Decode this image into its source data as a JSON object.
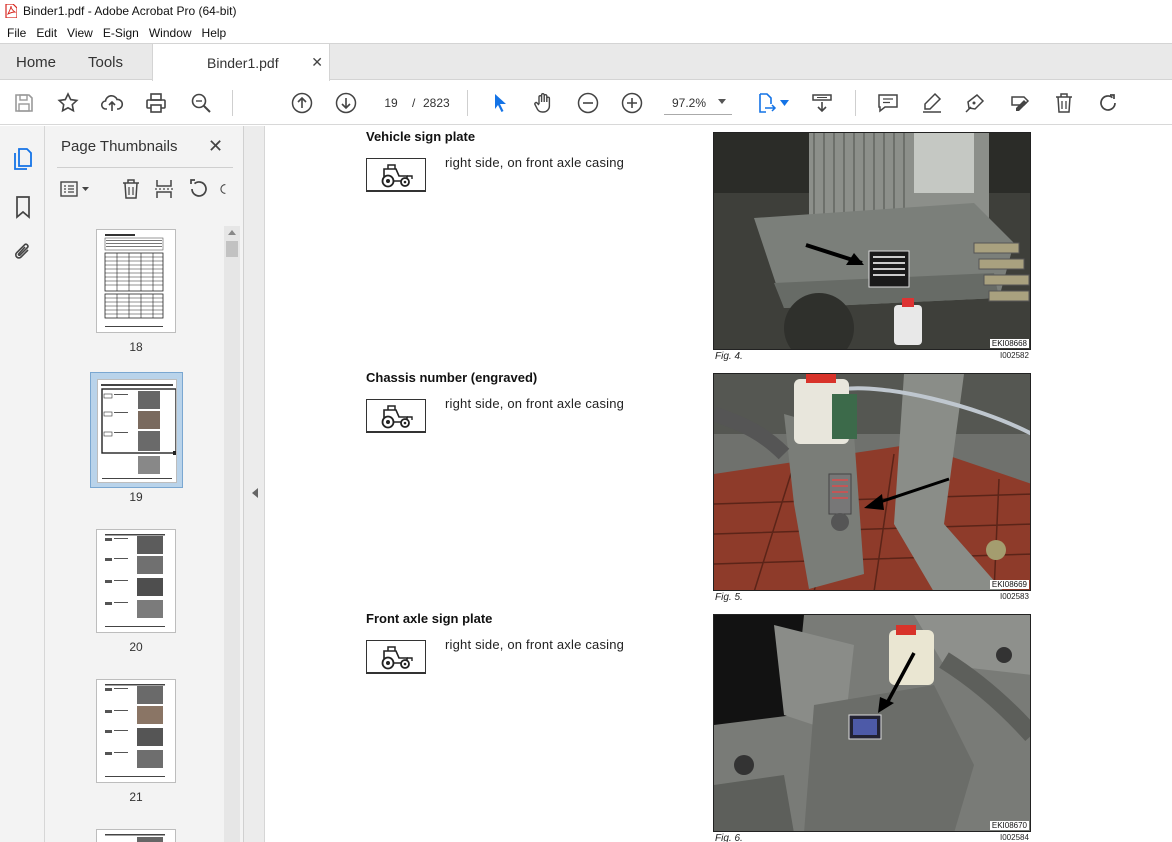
{
  "window": {
    "title": "Binder1.pdf - Adobe Acrobat Pro (64-bit)"
  },
  "menu": [
    "File",
    "Edit",
    "View",
    "E-Sign",
    "Window",
    "Help"
  ],
  "tabs": {
    "home": "Home",
    "tools": "Tools",
    "document": "Binder1.pdf"
  },
  "toolbar": {
    "current_page": "19",
    "page_separator": "/",
    "total_pages": "2823",
    "zoom": "97.2%"
  },
  "thumbnails_panel": {
    "title": "Page Thumbnails",
    "pages": [
      {
        "label": "18",
        "selected": false
      },
      {
        "label": "19",
        "selected": true
      },
      {
        "label": "20",
        "selected": false
      },
      {
        "label": "21",
        "selected": false
      }
    ]
  },
  "document": {
    "sections": [
      {
        "title": "Vehicle sign plate",
        "text": "right side, on front axle casing",
        "figure": "Fig. 4.",
        "photo_code": "EKI08668",
        "ref": "I002582"
      },
      {
        "title": "Chassis number (engraved)",
        "text": "right side, on front axle casing",
        "figure": "Fig. 5.",
        "photo_code": "EKI08669",
        "ref": "I002583"
      },
      {
        "title": "Front axle sign plate",
        "text": "right side, on front axle casing",
        "figure": "Fig. 6.",
        "photo_code": "EKI08670",
        "ref": "I002584"
      }
    ]
  },
  "colors": {
    "accent_blue": "#1473e6",
    "acrobat_red": "#d7261e",
    "selection": "#b9d3ea"
  },
  "icons": [
    "save-icon",
    "bookmark-star-icon",
    "upload-icon",
    "print-icon",
    "zoom-search-icon",
    "page-up-icon",
    "page-down-icon",
    "select-cursor-icon",
    "hand-icon",
    "zoom-out-icon",
    "zoom-in-icon",
    "page-fit-icon",
    "scroll-mode-icon",
    "comment-icon",
    "highlight-icon",
    "sign-icon",
    "redact-icon",
    "delete-icon",
    "redo-icon"
  ]
}
